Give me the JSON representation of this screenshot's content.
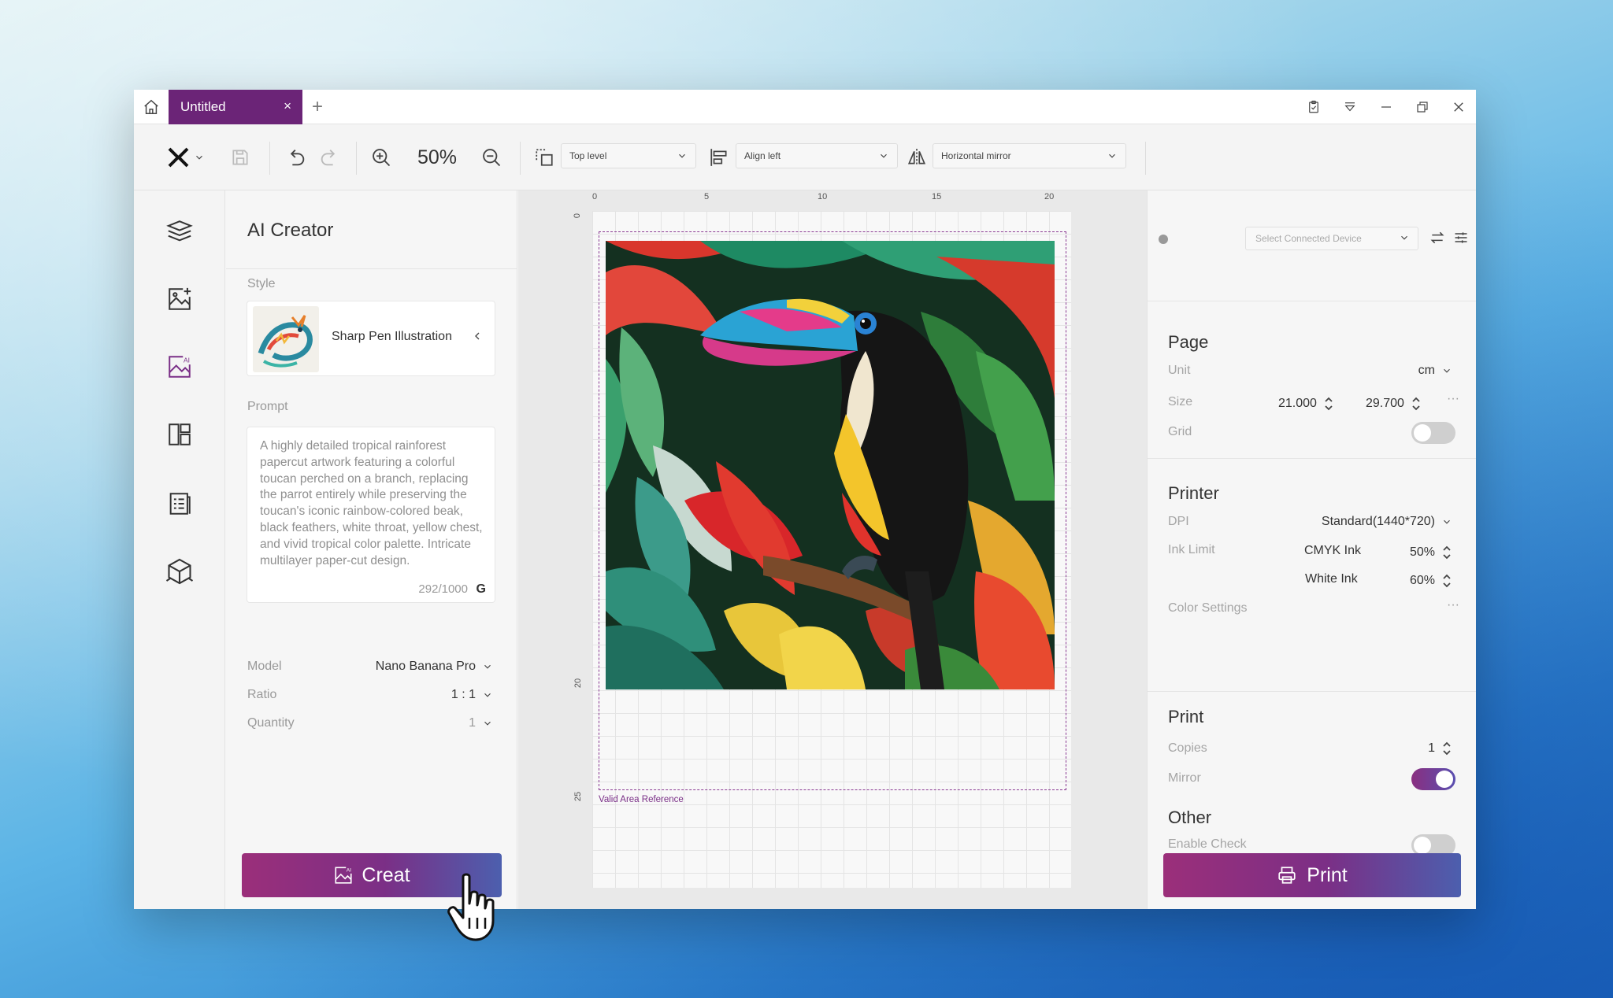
{
  "titlebar": {
    "tab_label": "Untitled",
    "tab_close": "×",
    "tab_add": "+"
  },
  "toolbar": {
    "zoom": "50%",
    "layer_dropdown": "Top level",
    "align_dropdown": "Align left",
    "mirror_dropdown": "Horizontal mirror"
  },
  "rail": {
    "icons": [
      "layers-icon",
      "add-image-icon",
      "ai-image-icon",
      "layout-icon",
      "document-list-icon",
      "cube-icon"
    ]
  },
  "ai_creator": {
    "title": "AI Creator",
    "style_label": "Style",
    "style_name": "Sharp Pen Illustration",
    "prompt_label": "Prompt",
    "prompt_text": "A highly detailed tropical rainforest papercut artwork featuring a colorful toucan perched on a branch, replacing the parrot entirely while preserving the toucan's iconic rainbow-colored beak, black feathers, white throat, yellow chest, and vivid tropical color palette. Intricate multilayer paper-cut design.",
    "prompt_count": "292/1000",
    "prompt_g": "G",
    "model_label": "Model",
    "model_value": "Nano Banana Pro",
    "ratio_label": "Ratio",
    "ratio_value": "1 : 1",
    "quantity_label": "Quantity",
    "quantity_value": "1",
    "create_button": "Creat"
  },
  "canvas": {
    "ruler_top": [
      "0",
      "5",
      "10",
      "15",
      "20"
    ],
    "ruler_left": [
      "0",
      "20",
      "25"
    ],
    "valid_area_label": "Valid Area Reference"
  },
  "right_panel": {
    "device_placeholder": "Select Connected Device",
    "page": {
      "title": "Page",
      "unit_label": "Unit",
      "unit_value": "cm",
      "size_label": "Size",
      "width": "21.000",
      "height": "29.700",
      "more": "···",
      "grid_label": "Grid"
    },
    "printer": {
      "title": "Printer",
      "dpi_label": "DPI",
      "dpi_value": "Standard(1440*720)",
      "ink_label": "Ink Limit",
      "cmyk_label": "CMYK Ink",
      "cmyk_value": "50%",
      "white_label": "White Ink",
      "white_value": "60%",
      "color_label": "Color Settings",
      "color_more": "···"
    },
    "print": {
      "title": "Print",
      "copies_label": "Copies",
      "copies_value": "1",
      "mirror_label": "Mirror"
    },
    "other": {
      "title": "Other",
      "check_label": "Enable Check"
    },
    "print_button": "Print"
  },
  "colors": {
    "accent": "#6b2477",
    "button_start": "#9b2f7a",
    "button_end": "#4c5fae"
  }
}
